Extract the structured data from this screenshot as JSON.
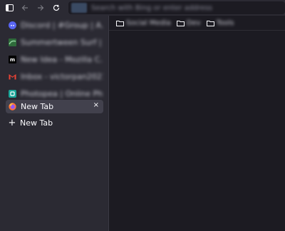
{
  "toolbar": {
    "sidebar_toggle_icon": "sidebar-icon",
    "back_icon": "back-arrow-icon",
    "forward_icon": "forward-arrow-icon",
    "reload_icon": "reload-icon",
    "url_placeholder": "Search with Bing or enter address"
  },
  "sidebar": {
    "tabs": [
      {
        "title": "Discord | #Group | A...",
        "favicon": "discord-icon",
        "favicon_color": "#5865f2"
      },
      {
        "title": "Summertween Surf | ...",
        "favicon": "surf-icon",
        "favicon_color": "#3aa757"
      },
      {
        "title": "New Idea - Mozilla C...",
        "favicon": "m-icon",
        "favicon_color": "#000000"
      },
      {
        "title": "Inbox - victorpan2021...",
        "favicon": "gmail-icon",
        "favicon_color": "#ea4335"
      },
      {
        "title": "Photopea | Online Ph...",
        "favicon": "photopea-icon",
        "favicon_color": "#18a497"
      }
    ],
    "selected_tab": {
      "title": "New Tab",
      "favicon": "firefox-icon",
      "close_label": "×"
    },
    "new_tab_plus": "+",
    "new_tab_label": "New Tab"
  },
  "bookmarks": [
    {
      "label": "Social Media"
    },
    {
      "label": "Dev"
    },
    {
      "label": "Tools"
    }
  ]
}
